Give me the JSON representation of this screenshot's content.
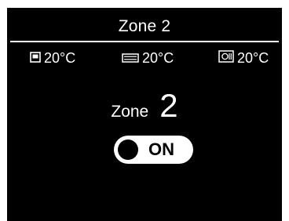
{
  "screen": {
    "title": "Zone 2",
    "temperatures": [
      {
        "icon": "floor-heating-icon",
        "value": "20°C"
      },
      {
        "icon": "radiator-icon",
        "value": "20°C"
      },
      {
        "icon": "fan-coil-icon",
        "value": "20°C"
      }
    ],
    "zone_label": "Zone",
    "zone_number": "2",
    "toggle": {
      "label": "ON",
      "state": "on"
    },
    "colors": {
      "background": "#000000",
      "foreground": "#ffffff"
    }
  }
}
